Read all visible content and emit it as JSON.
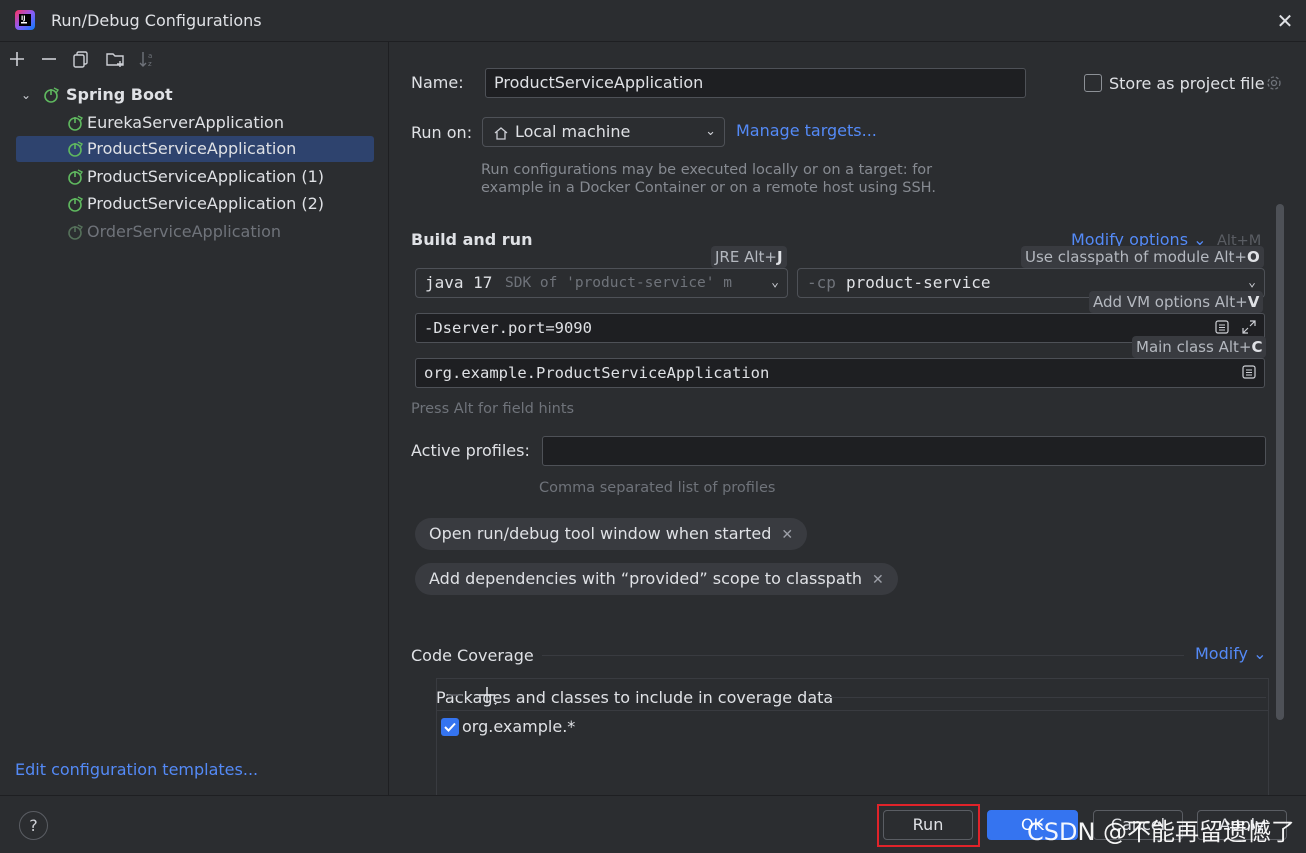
{
  "window": {
    "title": "Run/Debug Configurations"
  },
  "tree": {
    "group_label": "Spring Boot",
    "items": [
      {
        "label": "EurekaServerApplication"
      },
      {
        "label": "ProductServiceApplication"
      },
      {
        "label": "ProductServiceApplication (1)"
      },
      {
        "label": "ProductServiceApplication (2)"
      },
      {
        "label": "OrderServiceApplication"
      }
    ],
    "edit_templates_label": "Edit configuration templates..."
  },
  "form": {
    "name_label": "Name:",
    "name_value": "ProductServiceApplication",
    "store_label": "Store as project file",
    "run_on_label": "Run on:",
    "run_on_value": "Local machine",
    "manage_targets": "Manage targets...",
    "run_on_hint_1": "Run configurations may be executed locally or on a target: for",
    "run_on_hint_2": "example in a Docker Container or on a remote host using SSH.",
    "build_run_title": "Build and run",
    "modify_options": "Modify options",
    "modify_options_shortcut": "Alt+M",
    "jre_badge_prefix": "JRE Alt+",
    "jre_badge_key": "J",
    "classpath_badge_prefix": "Use classpath of module Alt+",
    "classpath_badge_key": "O",
    "vm_badge_prefix": "Add VM options Alt+",
    "vm_badge_key": "V",
    "main_badge_prefix": "Main class Alt+",
    "main_badge_key": "C",
    "jdk_main": "java 17",
    "jdk_detail": "SDK of 'product-service' m",
    "cp_prefix": "-cp",
    "cp_value": "product-service",
    "vm_options": "-Dserver.port=9090",
    "main_class": "org.example.ProductServiceApplication",
    "field_hint": "Press Alt for field hints",
    "profiles_label": "Active profiles:",
    "profiles_hint": "Comma separated list of profiles",
    "chip_1": "Open run/debug tool window when started",
    "chip_2": "Add dependencies with “provided” scope to classpath",
    "coverage_title": "Code Coverage",
    "coverage_modify": "Modify",
    "packages_title": "Packages and classes to include in coverage data",
    "package_item": "org.example.*"
  },
  "footer": {
    "help": "?",
    "run": "Run",
    "ok": "OK",
    "cancel": "Cancel",
    "apply": "Apply",
    "watermark": "CSDN @不能再留遗憾了"
  },
  "colors": {
    "accent": "#3574f0",
    "link": "#548af7",
    "selection": "#2e436e",
    "highlight_box": "#e0232a",
    "spring_green": "#5fb85f"
  }
}
